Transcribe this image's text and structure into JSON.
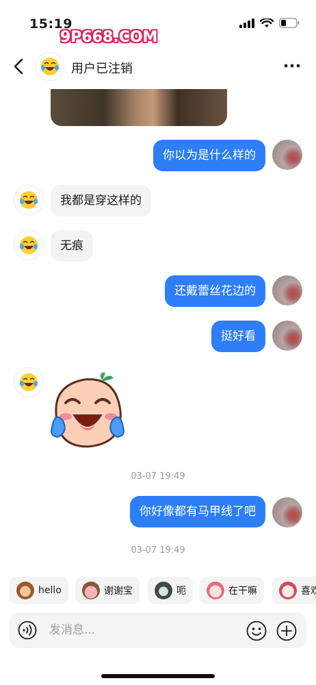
{
  "status_bar": {
    "time": "15:19",
    "watermark": "9P668.COM",
    "signal_icon": "cellular-signal-icon",
    "wifi_icon": "wifi-icon",
    "battery_icon": "battery-low-icon"
  },
  "header": {
    "title": "用户已注销",
    "back_icon": "chevron-left-icon",
    "more_icon": "more-dots-icon",
    "avatar_icon": "laughing-tears-emoji-icon"
  },
  "messages": [
    {
      "from": "me",
      "text": "你以为是什么样的"
    },
    {
      "from": "other",
      "text": "我都是穿这样的"
    },
    {
      "from": "other",
      "text": "无痕"
    },
    {
      "from": "me",
      "text": "还戴蕾丝花边的"
    },
    {
      "from": "me",
      "text": "挺好看"
    },
    {
      "from": "other",
      "sticker": "crying-laughing-bean-sticker"
    },
    {
      "from": "me",
      "text": "你好像都有马甲线了吧"
    }
  ],
  "timestamps": [
    "03-07 19:49",
    "03-07 19:49"
  ],
  "quick_replies": [
    {
      "label": "hello",
      "icon": "monkey-sticker-icon"
    },
    {
      "label": "谢谢宝",
      "icon": "pig-sticker-icon"
    },
    {
      "label": "呃",
      "icon": "cat-sticker-icon"
    },
    {
      "label": "在干嘛",
      "icon": "rabbit-sticker-icon"
    },
    {
      "label": "喜欢",
      "icon": "bear-sticker-icon"
    }
  ],
  "input": {
    "placeholder": "发消息...",
    "voice_icon": "voice-icon",
    "emoji_icon": "smile-icon",
    "plus_icon": "plus-circle-icon"
  },
  "colors": {
    "my_bubble": "#2d7ef7",
    "other_bubble": "#f3f3f3",
    "timestamp": "#9a9a9a"
  }
}
